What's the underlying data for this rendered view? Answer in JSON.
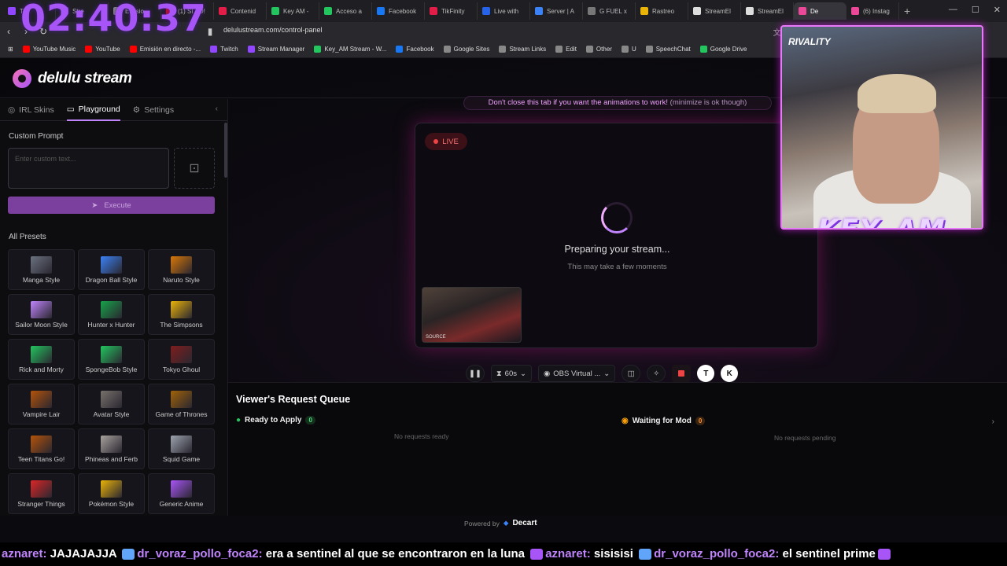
{
  "clock": "02:40:37",
  "tabs": [
    {
      "label": "Tw",
      "color": "#9146ff"
    },
    {
      "label": "Stre",
      "color": "#a855f7"
    },
    {
      "label": "Emisio",
      "color": "#888"
    },
    {
      "label": "(1) SI TO!",
      "color": "#ff0000"
    },
    {
      "label": "Contenid",
      "color": "#e11d48"
    },
    {
      "label": "Key AM -",
      "color": "#22c55e"
    },
    {
      "label": "Acceso a",
      "color": "#22c55e"
    },
    {
      "label": "Facebook",
      "color": "#1877f2"
    },
    {
      "label": "TikFinity",
      "color": "#e11d48"
    },
    {
      "label": "Live with",
      "color": "#2563eb"
    },
    {
      "label": "Server | A",
      "color": "#3b82f6"
    },
    {
      "label": "G FUEL x",
      "color": "#777"
    },
    {
      "label": "Rastreo",
      "color": "#eab308"
    },
    {
      "label": "StreamEl",
      "color": "#ddd"
    },
    {
      "label": "StreamEl",
      "color": "#ddd"
    },
    {
      "label": "De",
      "color": "#ec4899",
      "active": true
    },
    {
      "label": "(6) Instag",
      "color": "#ec4899"
    }
  ],
  "url": "delulustream.com/control-panel",
  "bookmarks": [
    {
      "label": "YouTube Music",
      "color": "#ff0000"
    },
    {
      "label": "YouTube",
      "color": "#ff0000"
    },
    {
      "label": "Emisión en directo -...",
      "color": "#ff0000"
    },
    {
      "label": "Twitch",
      "color": "#9146ff"
    },
    {
      "label": "Stream Manager",
      "color": "#9146ff"
    },
    {
      "label": "Key_AM Stream - W...",
      "color": "#22c55e"
    },
    {
      "label": "Facebook",
      "color": "#1877f2"
    },
    {
      "label": "Google Sites",
      "color": "#888"
    },
    {
      "label": "Stream Links",
      "color": "#888"
    },
    {
      "label": "Edit",
      "color": "#888"
    },
    {
      "label": "Other",
      "color": "#888"
    },
    {
      "label": "U",
      "color": "#888"
    },
    {
      "label": "SpeechChat",
      "color": "#888"
    },
    {
      "label": "Google Drive",
      "color": "#22c55e"
    }
  ],
  "app": {
    "logo": "delulu stream",
    "sidebar_tabs": [
      "IRL Skins",
      "Playground",
      "Settings"
    ],
    "custom_prompt_label": "Custom Prompt",
    "prompt_placeholder": "Enter custom text...",
    "execute_label": "Execute",
    "all_presets_label": "All Presets",
    "presets": [
      {
        "name": "Manga Style",
        "color": "#6b7280"
      },
      {
        "name": "Dragon Ball Style",
        "color": "#3b82f6"
      },
      {
        "name": "Naruto Style",
        "color": "#d97706"
      },
      {
        "name": "Sailor Moon Style",
        "color": "#c084fc"
      },
      {
        "name": "Hunter x Hunter",
        "color": "#16a34a"
      },
      {
        "name": "The Simpsons",
        "color": "#eab308"
      },
      {
        "name": "Rick and Morty",
        "color": "#22c55e"
      },
      {
        "name": "SpongeBob Style",
        "color": "#22c55e"
      },
      {
        "name": "Tokyo Ghoul",
        "color": "#7f1d1d"
      },
      {
        "name": "Vampire Lair",
        "color": "#b45309"
      },
      {
        "name": "Avatar Style",
        "color": "#78716c"
      },
      {
        "name": "Game of Thrones",
        "color": "#a16207"
      },
      {
        "name": "Teen Titans Go!",
        "color": "#b45309"
      },
      {
        "name": "Phineas and Ferb",
        "color": "#a8a29e"
      },
      {
        "name": "Squid Game",
        "color": "#9ca3af"
      },
      {
        "name": "Stranger Things",
        "color": "#dc2626"
      },
      {
        "name": "Pokémon Style",
        "color": "#eab308"
      },
      {
        "name": "Generic Anime",
        "color": "#a855f7"
      }
    ],
    "notice": "Don't close this tab if you want the animations to work!",
    "notice_sub": "(minimize is ok though)",
    "live_label": "LIVE",
    "prep_title": "Preparing your stream...",
    "prep_sub": "This may take a few moments",
    "source_label": "SOURCE",
    "duration": "60s",
    "camera": "OBS Virtual ...",
    "queue_title": "Viewer's Request Queue",
    "ready_label": "Ready to Apply",
    "ready_count": "0",
    "ready_empty": "No requests ready",
    "waiting_label": "Waiting for Mod",
    "waiting_count": "0",
    "waiting_empty": "No requests pending",
    "powered_by": "Powered by",
    "powered_brand": "Decart"
  },
  "overlay": {
    "cam_brand": "RIVALITY",
    "cam_name": "KEY_AM"
  },
  "chat": [
    {
      "user": "aznaret:",
      "msg": " JAJAJAJJA "
    },
    {
      "user": "dr_voraz_pollo_foca2:",
      "msg": " era a sentinel al que se encontraron en la luna "
    },
    {
      "user": "aznaret:",
      "msg": " sisisisi "
    },
    {
      "user": "dr_voraz_pollo_foca2:",
      "msg": " el sentinel prime"
    }
  ]
}
